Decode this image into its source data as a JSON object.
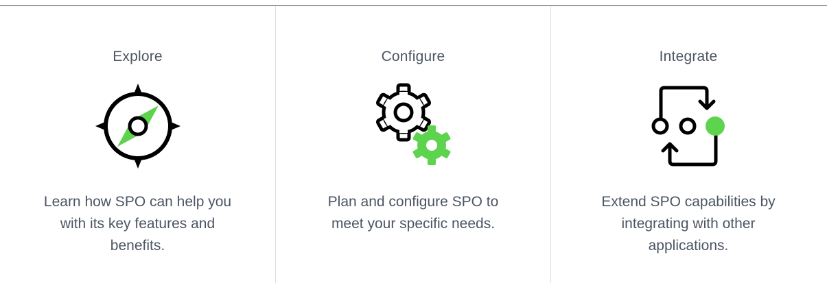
{
  "accent_color": "#5ed34e",
  "cards": [
    {
      "title": "Explore",
      "icon": "compass-icon",
      "description": "Learn how SPO can help you with its key features and benefits."
    },
    {
      "title": "Configure",
      "icon": "gears-icon",
      "description": "Plan and configure SPO to meet your specific needs."
    },
    {
      "title": "Integrate",
      "icon": "integration-cycle-icon",
      "description": "Extend SPO capabilities by integrating with other applications."
    }
  ]
}
